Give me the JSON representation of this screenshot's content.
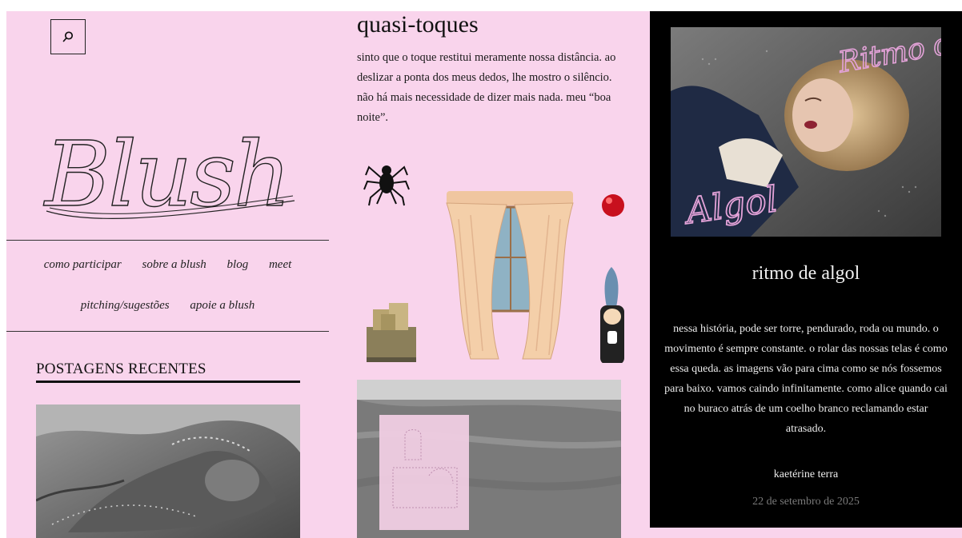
{
  "site": {
    "logo_text": "Blush"
  },
  "search": {
    "label": "search"
  },
  "nav": {
    "row1": [
      "como participar",
      "sobre a blush",
      "blog",
      "meet"
    ],
    "row2": [
      "pitching/sugestões",
      "apoie a blush"
    ]
  },
  "sidebar": {
    "recent_title": "POSTAGENS RECENTES"
  },
  "post": {
    "title": "quasi-toques",
    "excerpt": "sinto que o toque restitui meramente nossa distância. ao deslizar a ponta dos meus dedos, lhe mostro o silêncio. não há mais necessidade de dizer mais nada. meu “boa noite”."
  },
  "feature": {
    "image_script_top": "Ritmo de",
    "image_script_bottom": "Algol",
    "title": "ritmo de algol",
    "description": "nessa história, pode ser torre, pendurado, roda ou mundo. o movimento é sempre constante. o rolar das nossas telas é como essa queda. as imagens vão para cima como se nós fossemos para baixo. vamos caindo infinitamente. como alice quando cai no buraco atrás de um coelho branco reclamando estar atrasado.",
    "author": "kaetérine terra",
    "date": "22 de setembro de 2025"
  },
  "colors": {
    "page_bg": "#f9d4ec",
    "feature_bg": "#000000",
    "text": "#111111",
    "date": "#7a7a7a",
    "script_pink": "#e3a2d8"
  },
  "icons": {
    "search": "search-icon"
  }
}
